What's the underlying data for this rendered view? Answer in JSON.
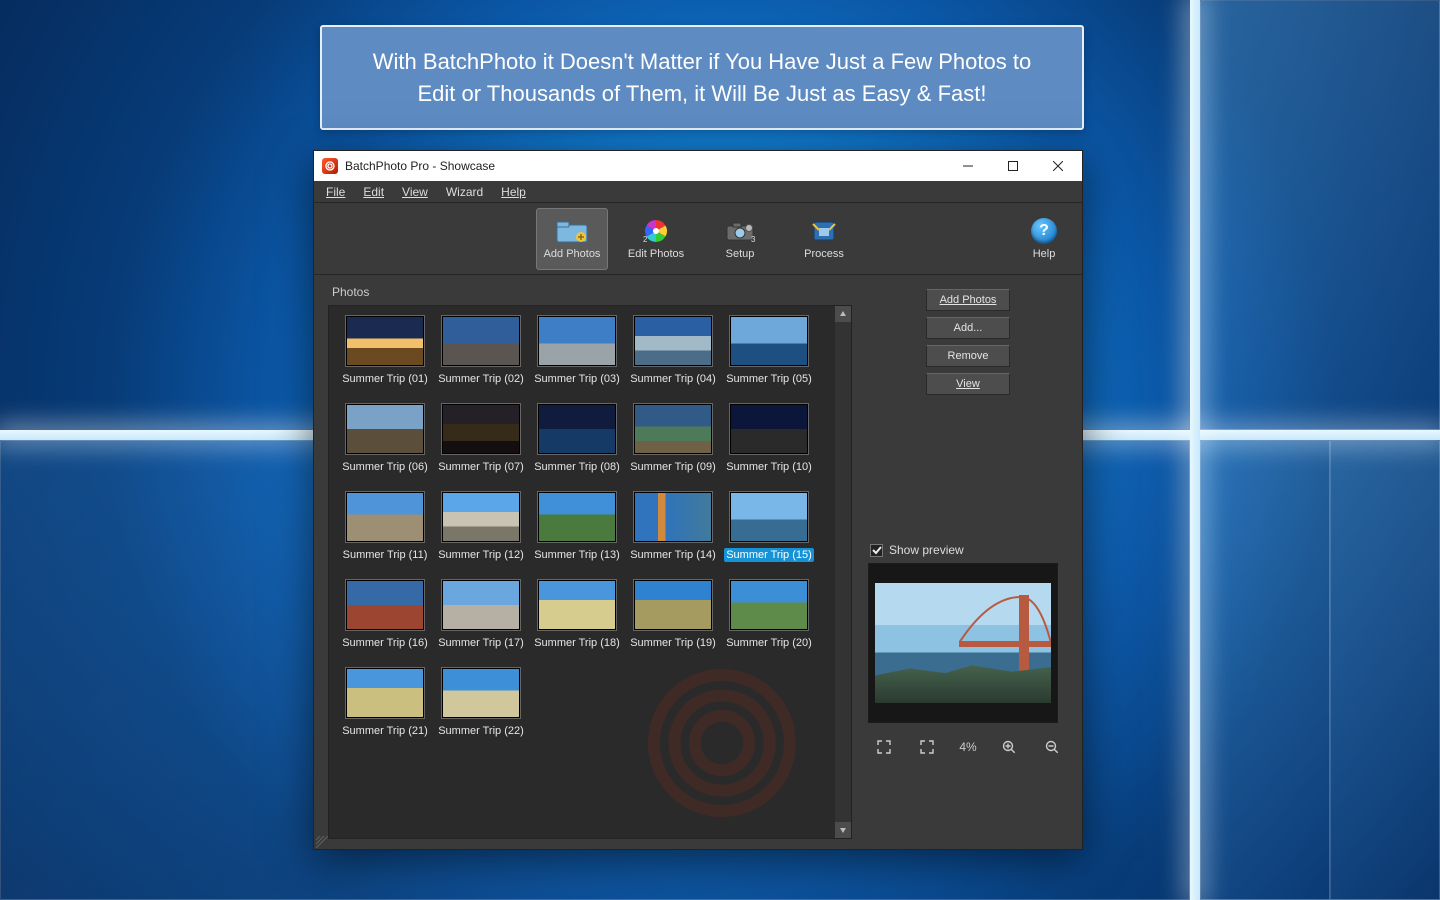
{
  "banner": {
    "text": "With BatchPhoto it Doesn't Matter if You Have Just a Few Photos to Edit or Thousands of Them, it Will Be Just as Easy & Fast!"
  },
  "window": {
    "title": "BatchPhoto Pro - Showcase"
  },
  "menubar": {
    "file": "File",
    "edit": "Edit",
    "view": "View",
    "wizard": "Wizard",
    "help": "Help"
  },
  "toolbar": {
    "add": {
      "label": "Add Photos"
    },
    "edit": {
      "label": "Edit Photos"
    },
    "setup": {
      "label": "Setup"
    },
    "process": {
      "label": "Process"
    },
    "help": {
      "label": "Help"
    }
  },
  "section": {
    "photos_label": "Photos"
  },
  "thumbs": [
    {
      "name": "Summer Trip (01)"
    },
    {
      "name": "Summer Trip (02)"
    },
    {
      "name": "Summer Trip (03)"
    },
    {
      "name": "Summer Trip (04)"
    },
    {
      "name": "Summer Trip (05)"
    },
    {
      "name": "Summer Trip (06)"
    },
    {
      "name": "Summer Trip (07)"
    },
    {
      "name": "Summer Trip (08)"
    },
    {
      "name": "Summer Trip (09)"
    },
    {
      "name": "Summer Trip (10)"
    },
    {
      "name": "Summer Trip (11)"
    },
    {
      "name": "Summer Trip (12)"
    },
    {
      "name": "Summer Trip (13)"
    },
    {
      "name": "Summer Trip (14)"
    },
    {
      "name": "Summer Trip (15)"
    },
    {
      "name": "Summer Trip (16)"
    },
    {
      "name": "Summer Trip (17)"
    },
    {
      "name": "Summer Trip (18)"
    },
    {
      "name": "Summer Trip (19)"
    },
    {
      "name": "Summer Trip (20)"
    },
    {
      "name": "Summer Trip (21)"
    },
    {
      "name": "Summer Trip (22)"
    }
  ],
  "selected_index": 14,
  "side": {
    "add_photos": "Add Photos",
    "add": "Add...",
    "remove": "Remove",
    "view": "View"
  },
  "preview": {
    "checkbox_label": "Show preview",
    "checked": true,
    "zoom_pct": "4%"
  }
}
